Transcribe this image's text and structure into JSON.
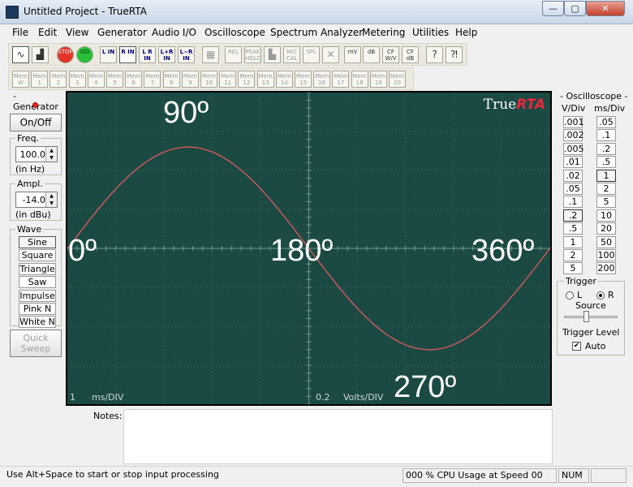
{
  "window": {
    "title": "Untitled Project - TrueRTA",
    "minimize": "—",
    "maximize": "▢",
    "close": "✕"
  },
  "menu": [
    "File",
    "Edit",
    "View",
    "Generator",
    "Audio I/O",
    "Oscilloscope",
    "Spectrum Analyzer",
    "Metering",
    "Utilities",
    "Help"
  ],
  "toolbar1": [
    {
      "label": "",
      "icon": "∿",
      "name": "scope-mode"
    },
    {
      "label": "",
      "icon": "▟",
      "name": "spectrum-mode"
    },
    {
      "label": "STOP",
      "name": "stop"
    },
    {
      "label": "GO",
      "name": "go"
    },
    {
      "label": "L IN",
      "name": "left-input"
    },
    {
      "label": "R IN",
      "name": "right-input"
    },
    {
      "label": "L R IN",
      "name": "lr-input"
    },
    {
      "label": "L+R IN",
      "name": "lplusr-input"
    },
    {
      "label": "L−R IN",
      "name": "lminusr-input"
    },
    {
      "label": "",
      "icon": "▦",
      "name": "grid"
    },
    {
      "label": "REL",
      "name": "relative"
    },
    {
      "label": "PEAK HOLD",
      "name": "peak-hold"
    },
    {
      "label": "",
      "icon": "▙",
      "name": "bars"
    },
    {
      "label": "MIC CAL",
      "name": "mic-cal"
    },
    {
      "label": "SPL",
      "name": "spl"
    },
    {
      "label": "",
      "icon": "✕",
      "name": "clear"
    },
    {
      "label": "mV",
      "name": "millivolts"
    },
    {
      "label": "dB",
      "name": "decibels"
    },
    {
      "label": "CF W/V",
      "name": "cf-wv"
    },
    {
      "label": "CF dB",
      "name": "cf-db"
    },
    {
      "label": "",
      "icon": "?",
      "name": "help"
    },
    {
      "label": "",
      "icon": "⁈",
      "name": "context-help"
    }
  ],
  "toolbar2": [
    "Mem W",
    "Mem 1",
    "Mem 2",
    "Mem 3",
    "Mem 4",
    "Mem 5",
    "Mem 6",
    "Mem 7",
    "Mem 8",
    "Mem 9",
    "Mem 10",
    "Mem 11",
    "Mem 12",
    "Mem 13",
    "Mem 14",
    "Mem 15",
    "Mem 16",
    "Mem 17",
    "Mem 18",
    "Mem 19",
    "Mem 20"
  ],
  "generator": {
    "title": "- Generator -",
    "onoff": "On/Off",
    "freq_label": "Freq.",
    "freq_value": "100.0",
    "freq_unit": "(in Hz)",
    "ampl_label": "Ampl.",
    "ampl_value": "-14.0",
    "ampl_unit": "(in dBu)",
    "wave_label": "Wave",
    "waves": [
      "Sine",
      "Square",
      "Triangle",
      "Saw",
      "Impulse",
      "Pink N",
      "White N"
    ],
    "selected_wave": "Sine",
    "quick_sweep": "Quick Sweep"
  },
  "scope": {
    "brand_plain": "True",
    "brand_accent": "RTA",
    "time_div_value": "1",
    "time_div_unit": "ms/DIV",
    "volt_div_value": "0.2",
    "volt_div_unit": "Volts/DIV",
    "angles": [
      "0º",
      "90º",
      "180º",
      "270º",
      "360º"
    ],
    "trace_color": "#e05a5a",
    "background_color": "#1a4a43"
  },
  "chart_data": {
    "type": "line",
    "series": [
      {
        "x_degrees": [
          0,
          45,
          90,
          135,
          180,
          225,
          270,
          315,
          360
        ],
        "y_divisions": [
          0,
          1.84,
          2.6,
          1.84,
          0,
          -1.84,
          -2.6,
          -1.84,
          0
        ]
      }
    ],
    "ylim": [
      -4,
      4
    ],
    "xlim": [
      0,
      360
    ],
    "grid": true
  },
  "oscilloscope_panel": {
    "title": "- Oscilloscope -",
    "vdiv_label": "V/Div",
    "msdiv_label": "ms/Div",
    "vdiv": [
      ".001",
      ".002",
      ".005",
      ".01",
      ".02",
      ".05",
      ".1",
      ".2",
      ".5",
      "1",
      "2",
      "5"
    ],
    "msdiv": [
      ".05",
      ".1",
      ".2",
      ".5",
      "1",
      "2",
      "5",
      "10",
      "20",
      "50",
      "100",
      "200"
    ],
    "vdiv_selected": ".2",
    "msdiv_selected": "1"
  },
  "trigger": {
    "title": "Trigger",
    "l_label": "L",
    "r_label": "R",
    "source_label": "Source",
    "level_label": "Trigger Level",
    "auto_label": "Auto",
    "selected_source": "R",
    "auto_checked": true,
    "level_fraction": 0.4
  },
  "notes": {
    "label": "Notes:"
  },
  "status": {
    "hint": "Use Alt+Space to start or stop input processing",
    "cpu": "000 % CPU Usage at Speed 00",
    "num": "NUM"
  }
}
